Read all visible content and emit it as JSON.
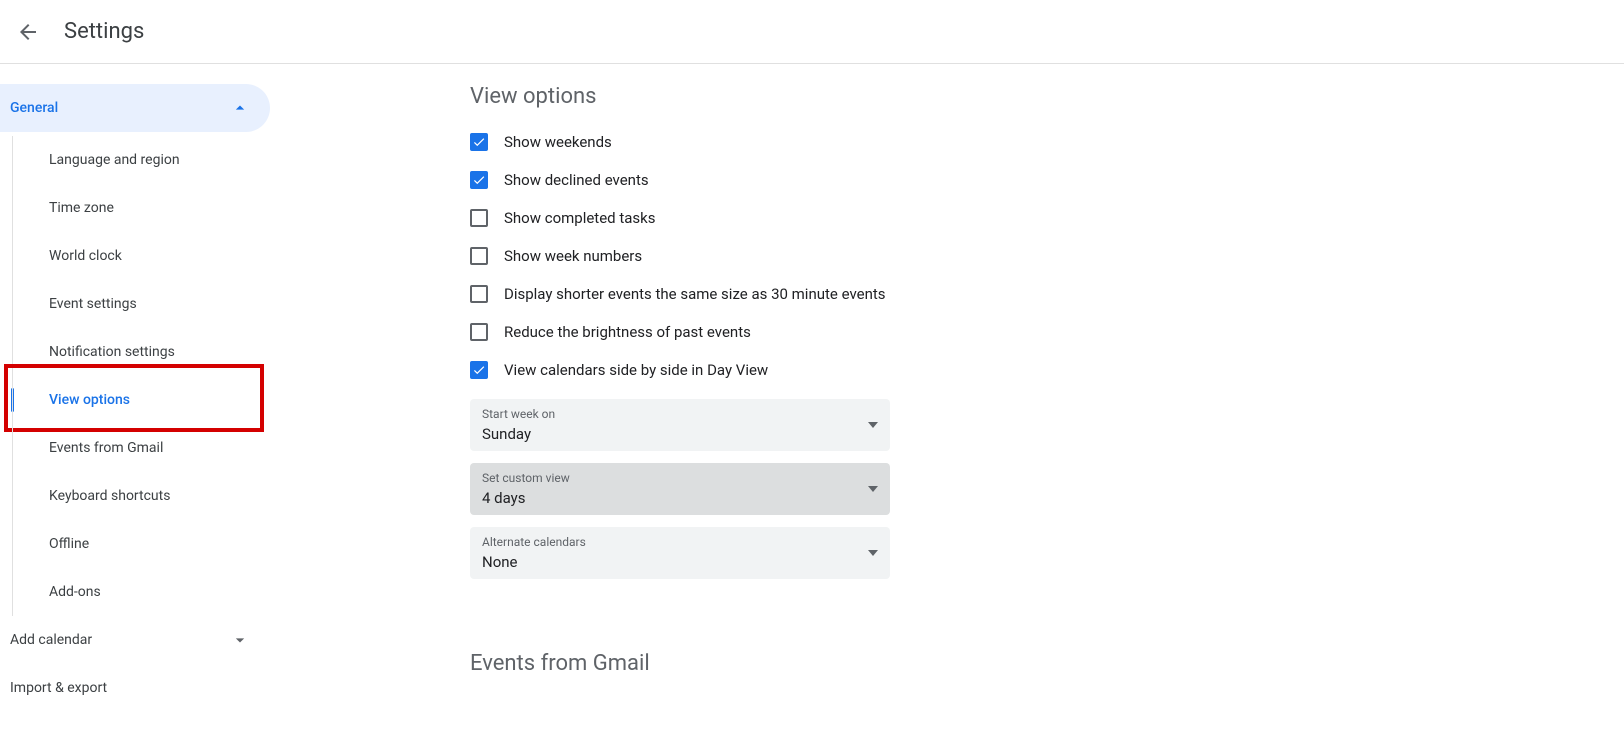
{
  "header": {
    "title": "Settings"
  },
  "sidebar": {
    "general_label": "General",
    "items": [
      "Language and region",
      "Time zone",
      "World clock",
      "Event settings",
      "Notification settings",
      "View options",
      "Events from Gmail",
      "Keyboard shortcuts",
      "Offline",
      "Add-ons"
    ],
    "add_calendar": "Add calendar",
    "import_export": "Import & export"
  },
  "view_options": {
    "title": "View options",
    "checks": [
      {
        "label": "Show weekends",
        "checked": true
      },
      {
        "label": "Show declined events",
        "checked": true
      },
      {
        "label": "Show completed tasks",
        "checked": false
      },
      {
        "label": "Show week numbers",
        "checked": false
      },
      {
        "label": "Display shorter events the same size as 30 minute events",
        "checked": false
      },
      {
        "label": "Reduce the brightness of past events",
        "checked": false
      },
      {
        "label": "View calendars side by side in Day View",
        "checked": true
      }
    ],
    "selects": [
      {
        "label": "Start week on",
        "value": "Sunday",
        "hover": false
      },
      {
        "label": "Set custom view",
        "value": "4 days",
        "hover": true
      },
      {
        "label": "Alternate calendars",
        "value": "None",
        "hover": false
      }
    ]
  },
  "next_section": {
    "title": "Events from Gmail"
  }
}
